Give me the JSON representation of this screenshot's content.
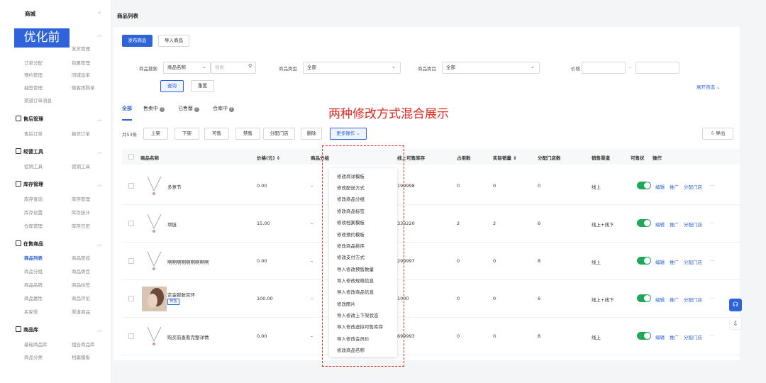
{
  "sidebar": {
    "title": "商城",
    "collapse_icon": "«",
    "badge": "优化前",
    "top_items": [
      "发货管理",
      "订单分配",
      "包裹管理",
      "预约管理",
      "同城运单",
      "抽签管理",
      "微客团购单",
      "渠道订单消息"
    ],
    "groups": [
      {
        "label": "售后管理",
        "items": [
          "售后订单",
          "换货订单"
        ]
      },
      {
        "label": "经营工具",
        "items": [
          "促销工具",
          "营销工具"
        ]
      },
      {
        "label": "库存管理",
        "items": [
          "库存查询",
          "库存管理",
          "库存设置",
          "库存统计",
          "仓库管理",
          "库存日历"
        ]
      },
      {
        "label": "在售商品",
        "items": [
          "商品列表",
          "商品管控",
          "商品分组",
          "商品类目",
          "商品品牌",
          "商品标签",
          "商品属性",
          "商品评论",
          "买家秀",
          "渠道商品"
        ]
      },
      {
        "label": "商品库",
        "items": [
          "基础商品库",
          "组合商品库",
          "商品分类",
          "档案模板"
        ]
      }
    ],
    "active_item": "商品列表"
  },
  "page": {
    "title": "商品列表"
  },
  "toolbar": {
    "publish": "发布商品",
    "import": "导入商品"
  },
  "filters": {
    "search_label": "商品搜索",
    "search_field": "商品名称",
    "search_placeholder": "搜索",
    "type_label": "商品类型",
    "type_value": "全部",
    "category_label": "商品类目",
    "category_value": "全部",
    "price_label": "价格",
    "price_sep": "-",
    "query": "查询",
    "reset": "重置",
    "expand": "展开筛选"
  },
  "tabs": [
    "全部",
    "售卖中",
    "已售罄",
    "仓库中"
  ],
  "annotation": "两种修改方式混合展示",
  "actions": {
    "count": "共53条",
    "buttons": [
      "上架",
      "下架",
      "可售",
      "禁售",
      "分配门店",
      "删除"
    ],
    "more": "更多操作",
    "export": "导出"
  },
  "table": {
    "headers": [
      "商品名称",
      "价格(元)",
      "商品分组",
      "线上可售库存",
      "占用数",
      "实际销量",
      "分配门店数",
      "销售渠道",
      "可售状",
      "操作"
    ],
    "rows": [
      {
        "name": "多意节",
        "price": "0.00",
        "group": "–",
        "stock": "199998",
        "occupied": "0",
        "sold": "0",
        "stores": "0",
        "channel": "线上",
        "tag": ""
      },
      {
        "name": "项链",
        "price": "15.00",
        "group": "–",
        "stock": "333220",
        "occupied": "2",
        "sold": "2",
        "stores": "6",
        "channel": "线上+线下",
        "tag": ""
      },
      {
        "name": "啊啊啊啊啊啊啊啊啊",
        "price": "0.00",
        "group": "–",
        "stock": "299997",
        "occupied": "0",
        "sold": "0",
        "stores": "8",
        "channel": "线上",
        "tag": ""
      },
      {
        "name": "定金膨胀耳环",
        "price": "100.00",
        "group": "–",
        "stock": "1000",
        "occupied": "0",
        "sold": "0",
        "stores": "6",
        "channel": "线上+线下",
        "tag": "预售"
      },
      {
        "name": "购买前查看完整详情",
        "price": "0.00",
        "group": "–",
        "stock": "699993",
        "occupied": "0",
        "sold": "0",
        "stores": "8",
        "channel": "线上",
        "tag": ""
      }
    ],
    "row_actions": [
      "编辑",
      "推广",
      "分配门店",
      "···"
    ]
  },
  "more_menu": [
    "修改商详模板",
    "修改配送方式",
    "修改商品分组",
    "修改商品标签",
    "修改档案模板",
    "修改预约模板",
    "修改商品排序",
    "修改支付方式",
    "导入修改预售数量",
    "导入修改规格信息",
    "导入修改商品信息",
    "修改图片",
    "导入修改上下架状态",
    "导入修改虚拟可售库存",
    "导入修改会员价",
    "修改商品名称"
  ],
  "colors": {
    "accent": "#2f63d9",
    "annotation": "#e0281e",
    "toggle": "#1fa85a"
  }
}
